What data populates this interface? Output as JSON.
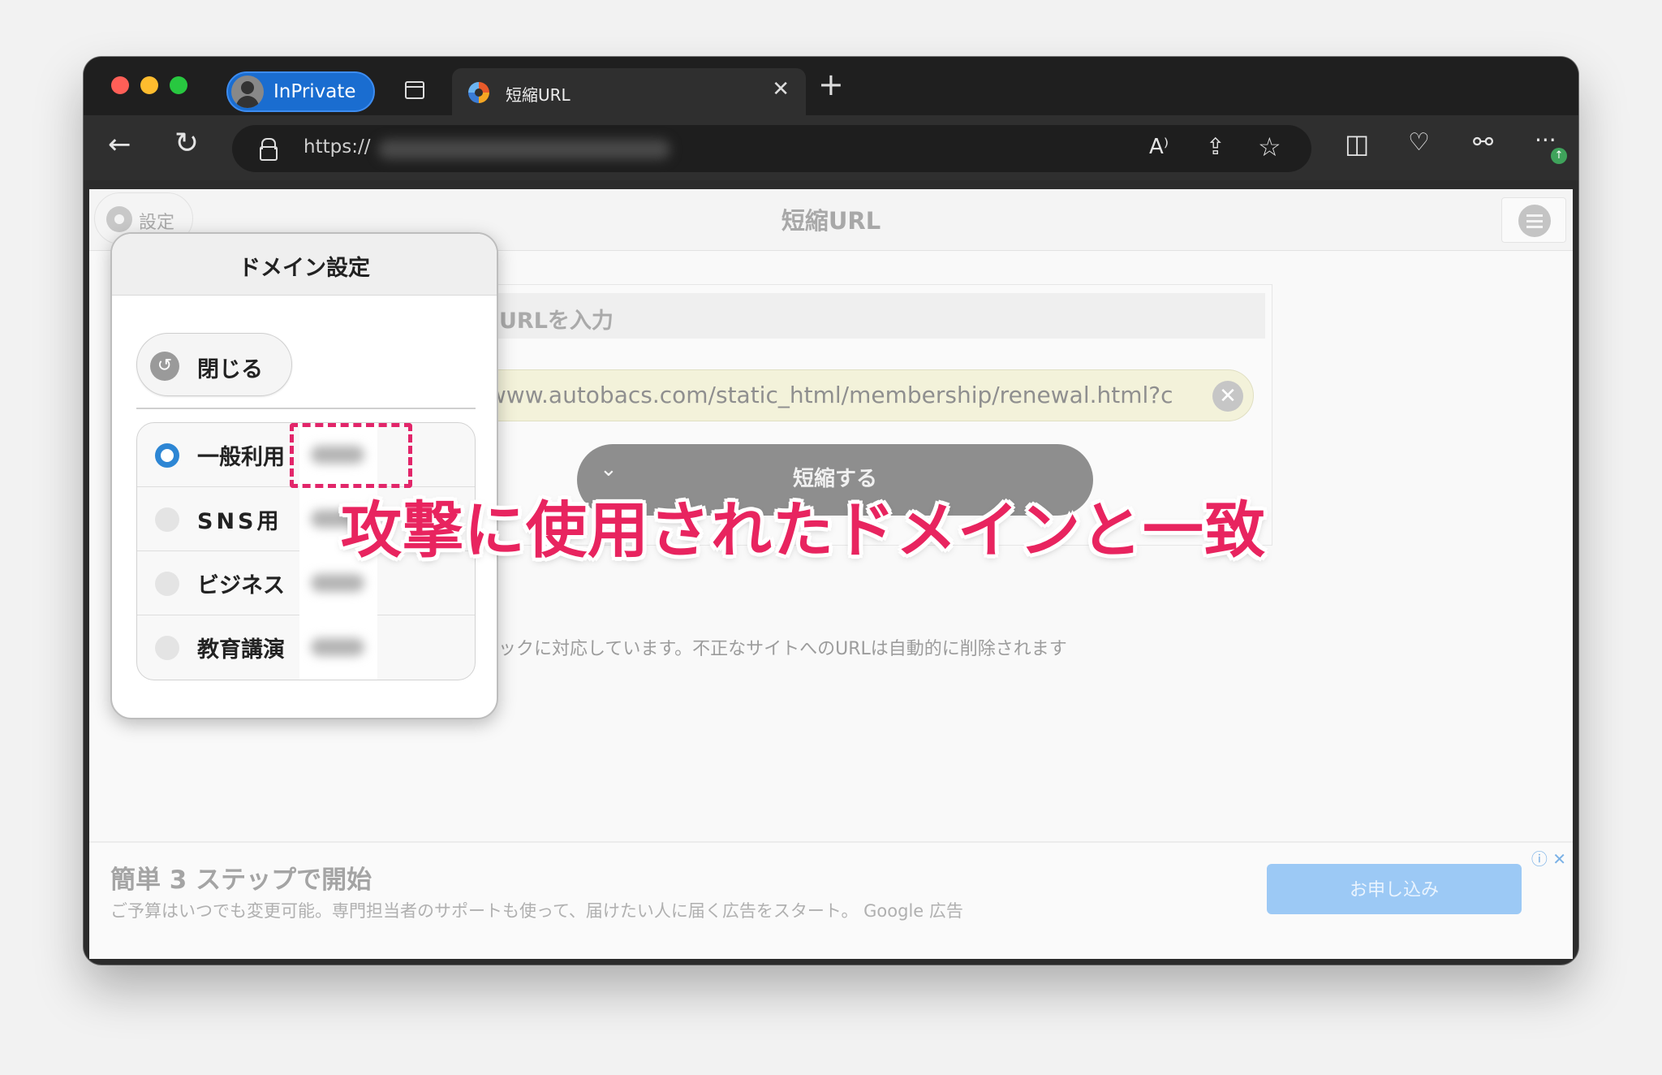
{
  "browser": {
    "inprivate_label": "InPrivate",
    "tab": {
      "title": "短縮URL",
      "close_glyph": "✕"
    },
    "new_tab_glyph": "+",
    "address": {
      "url_visible": "https://"
    },
    "toolbar_glyphs": {
      "back": "←",
      "reload": "↻",
      "read_aloud": "A⁾",
      "share": "⇪",
      "favorite": "☆",
      "split": "◫",
      "health": "♡",
      "extensions": "⚯",
      "more": "···"
    },
    "update_badge": "↑",
    "traffic_colors": [
      "#ff5f57",
      "#febc2e",
      "#28c840"
    ],
    "accent": "#1a6dd0"
  },
  "app": {
    "title": "短縮URL",
    "settings_label": "設定",
    "input_label": "たいURLを入力",
    "url_value": "s://www.autobacs.com/static_html/membership/renewal.html?c",
    "clear_glyph": "✕",
    "shorten_label": "短縮する",
    "shorten_chevron": "⌄",
    "notice": "ェックに対応しています。不正なサイトへのURLは自動的に削除されます"
  },
  "ad": {
    "title": "簡単 3 ステップで開始",
    "description": "ご予算はいつでも変更可能。専門担当者のサポートも使って、届けたい人に届く広告をスタート。 Google 広告",
    "button": "お申し込み",
    "info_glyph": "ⓘ",
    "close_glyph": "✕"
  },
  "popup": {
    "title": "ドメイン設定",
    "close_label": "閉じる",
    "close_icon": "↺",
    "options": [
      {
        "label": "一般利用",
        "selected": true
      },
      {
        "label": "SNS用",
        "selected": false
      },
      {
        "label": "ビジネス",
        "selected": false
      },
      {
        "label": "教育講演",
        "selected": false
      }
    ]
  },
  "annotation": {
    "text": "攻撃に使用されたドメインと一致",
    "color": "#e8245f"
  }
}
